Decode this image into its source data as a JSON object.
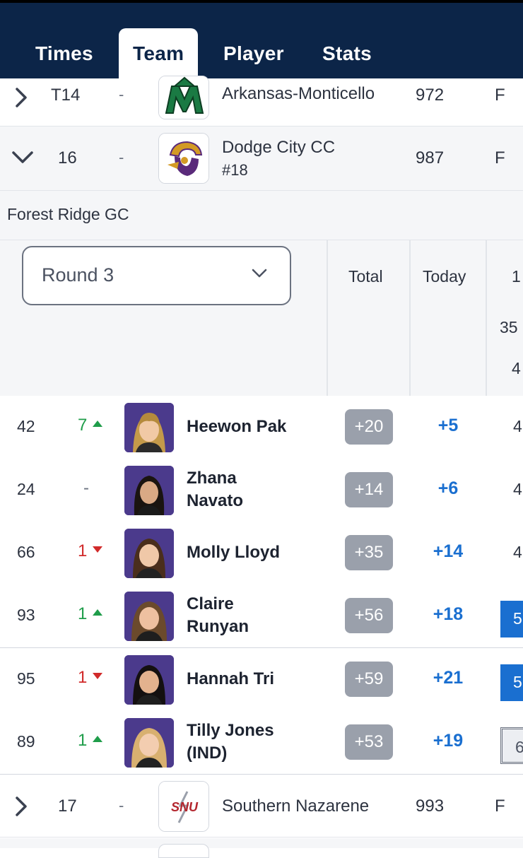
{
  "tabs": [
    {
      "label": "Times"
    },
    {
      "label": "Team"
    },
    {
      "label": "Player"
    },
    {
      "label": "Stats"
    }
  ],
  "teams_above": [
    {
      "rank": "T14",
      "move": "-",
      "name": "Arkansas-Monticello",
      "score": "972",
      "status": "F",
      "logo_text": "M"
    },
    {
      "rank": "16",
      "move": "-",
      "name": "Dodge City CC",
      "seed": "#18",
      "score": "987",
      "status": "F"
    }
  ],
  "course": "Forest Ridge GC",
  "round_select": {
    "value": "Round 3"
  },
  "columns": {
    "total": "Total",
    "today": "Today",
    "hole": "1",
    "yards": "35",
    "par": "4"
  },
  "players": [
    {
      "place": "42",
      "move": "7",
      "dir": "up",
      "name": "Heewon Pak",
      "total": "+20",
      "today": "+5",
      "hole1": "4"
    },
    {
      "place": "24",
      "move": "-",
      "dir": "none",
      "name": "Zhana Navato",
      "total": "+14",
      "today": "+6",
      "hole1": "4"
    },
    {
      "place": "66",
      "move": "1",
      "dir": "down",
      "name": "Molly Lloyd",
      "total": "+35",
      "today": "+14",
      "hole1": "4"
    },
    {
      "place": "93",
      "move": "1",
      "dir": "up",
      "name": "Claire Runyan",
      "total": "+56",
      "today": "+18",
      "hole1": "5"
    },
    {
      "place": "95",
      "move": "1",
      "dir": "down",
      "name": "Hannah Tri",
      "total": "+59",
      "today": "+21",
      "hole1": "5"
    },
    {
      "place": "89",
      "move": "1",
      "dir": "up",
      "name": "Tilly Jones (IND)",
      "total": "+53",
      "today": "+19",
      "hole1": "6"
    }
  ],
  "teams_below": [
    {
      "rank": "17",
      "move": "-",
      "name": "Southern Nazarene",
      "score": "993",
      "status": "F",
      "logo_text": "SNU"
    }
  ],
  "colors": {
    "nav": "#0c2548",
    "link_blue": "#1a6fd0",
    "up": "#1f9d4a",
    "down": "#d12a2a",
    "counting_bar": "#d12a2a"
  }
}
